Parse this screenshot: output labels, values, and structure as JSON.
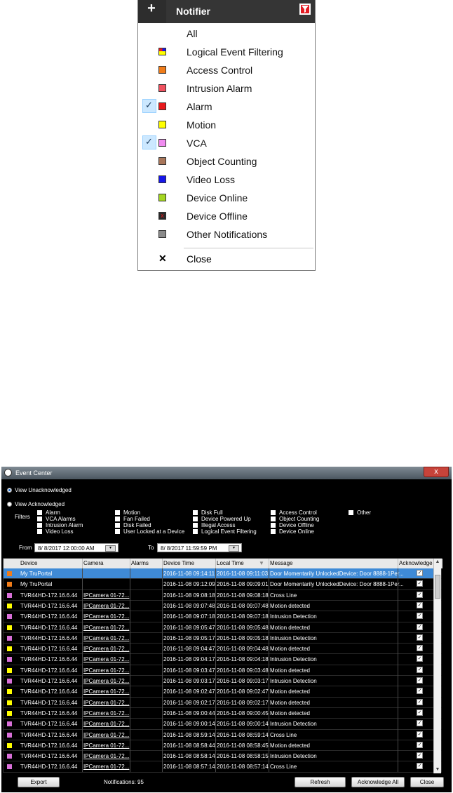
{
  "notifier": {
    "plus_label": "+",
    "title": "Notifier",
    "filter_icon": "funnel-icon",
    "items": [
      {
        "label": "All",
        "color": "",
        "checked": false,
        "icon": ""
      },
      {
        "label": "Logical Event Filtering",
        "color": "multi",
        "checked": false,
        "icon": "multicolor-square-icon"
      },
      {
        "label": "Access Control",
        "color": "#f07c19",
        "checked": false,
        "icon": ""
      },
      {
        "label": "Intrusion Alarm",
        "color": "#f0515f",
        "checked": false,
        "icon": ""
      },
      {
        "label": "Alarm",
        "color": "#e8191c",
        "checked": true,
        "icon": ""
      },
      {
        "label": "Motion",
        "color": "#ffff00",
        "checked": false,
        "icon": ""
      },
      {
        "label": "VCA",
        "color": "#f08cf0",
        "checked": true,
        "icon": ""
      },
      {
        "label": "Object Counting",
        "color": "#a8765a",
        "checked": false,
        "icon": ""
      },
      {
        "label": "Video Loss",
        "color": "#1616e8",
        "checked": false,
        "icon": ""
      },
      {
        "label": "Device Online",
        "color": "#a4d620",
        "checked": false,
        "icon": ""
      },
      {
        "label": "Device Offline",
        "color": "#2a2a2a",
        "checked": false,
        "icon": "offline-x-icon"
      },
      {
        "label": "Other Notifications",
        "color": "#8a8a8a",
        "checked": false,
        "icon": ""
      }
    ],
    "close_label": "Close"
  },
  "event_center": {
    "title": "Event Center",
    "close_glyph": "x",
    "view_unacknowledged": "View Unacknowledged",
    "view_acknowledged": "View Acknowledged",
    "filters_label": "Filters",
    "filters": [
      [
        "Alarm",
        "VCA Alarms",
        "Intrusion Alarm",
        "Video Loss"
      ],
      [
        "Motion",
        "Fan Failed",
        "Disk Failed",
        "User Locked at a Device"
      ],
      [
        "Disk Full",
        "Device Powered Up",
        "Illegal Access",
        "Logical Event Filtering"
      ],
      [
        "Access Control",
        "Object Counting",
        "Device Offline",
        "Device Online"
      ],
      [
        "Other"
      ]
    ],
    "from_label": "From",
    "from_value": "8/ 8/2017 12:00:00 AM",
    "to_label": "To",
    "to_value": "8/ 8/2017 11:59:59 PM",
    "columns": [
      "Device",
      "Camera",
      "Alarms",
      "Device Time",
      "Local Time",
      "Message",
      "Acknowledge"
    ],
    "rows": [
      {
        "color": "#f07c19",
        "device": "My TruPortal",
        "camera": "",
        "alarms": "",
        "device_time": "2016-11-08 09:14:11",
        "local_time": "2016-11-08 09:11:03",
        "message": "Door Momentarily UnlockedDevice: Door 8888-1Per...",
        "selected": true
      },
      {
        "color": "#f07c19",
        "device": "My TruPortal",
        "camera": "",
        "alarms": "",
        "device_time": "2016-11-08 09:12:09",
        "local_time": "2016-11-08 09:09:01",
        "message": "Door Momentarily UnlockedDevice: Door 8888-1Per...",
        "selected": false
      },
      {
        "color": "#d86fd8",
        "device": "TVR44HD-172.16.6.44",
        "camera": "IPCamera 01-72...",
        "alarms": "",
        "device_time": "2016-11-08 09:08:18",
        "local_time": "2016-11-08 09:08:18",
        "message": "Cross Line",
        "selected": false
      },
      {
        "color": "#ffff00",
        "device": "TVR44HD-172.16.6.44",
        "camera": "IPCamera 01-72...",
        "alarms": "",
        "device_time": "2016-11-08 09:07:48",
        "local_time": "2016-11-08 09:07:48",
        "message": "Motion detected",
        "selected": false
      },
      {
        "color": "#d86fd8",
        "device": "TVR44HD-172.16.6.44",
        "camera": "IPCamera 01-72...",
        "alarms": "",
        "device_time": "2016-11-08 09:07:18",
        "local_time": "2016-11-08 09:07:18",
        "message": "Intrusion Detection",
        "selected": false
      },
      {
        "color": "#ffff00",
        "device": "TVR44HD-172.16.6.44",
        "camera": "IPCamera 01-72...",
        "alarms": "",
        "device_time": "2016-11-08 09:05:47",
        "local_time": "2016-11-08 09:05:48",
        "message": "Motion detected",
        "selected": false
      },
      {
        "color": "#d86fd8",
        "device": "TVR44HD-172.16.6.44",
        "camera": "IPCamera 01-72...",
        "alarms": "",
        "device_time": "2016-11-08 09:05:17",
        "local_time": "2016-11-08 09:05:18",
        "message": "Intrusion Detection",
        "selected": false
      },
      {
        "color": "#ffff00",
        "device": "TVR44HD-172.16.6.44",
        "camera": "IPCamera 01-72...",
        "alarms": "",
        "device_time": "2016-11-08 09:04:47",
        "local_time": "2016-11-08 09:04:48",
        "message": "Motion detected",
        "selected": false
      },
      {
        "color": "#d86fd8",
        "device": "TVR44HD-172.16.6.44",
        "camera": "IPCamera 01-72...",
        "alarms": "",
        "device_time": "2016-11-08 09:04:17",
        "local_time": "2016-11-08 09:04:18",
        "message": "Intrusion Detection",
        "selected": false
      },
      {
        "color": "#ffff00",
        "device": "TVR44HD-172.16.6.44",
        "camera": "IPCamera 01-72...",
        "alarms": "",
        "device_time": "2016-11-08 09:03:47",
        "local_time": "2016-11-08 09:03:48",
        "message": "Motion detected",
        "selected": false
      },
      {
        "color": "#d86fd8",
        "device": "TVR44HD-172.16.6.44",
        "camera": "IPCamera 01-72...",
        "alarms": "",
        "device_time": "2016-11-08 09:03:17",
        "local_time": "2016-11-08 09:03:17",
        "message": "Intrusion Detection",
        "selected": false
      },
      {
        "color": "#ffff00",
        "device": "TVR44HD-172.16.6.44",
        "camera": "IPCamera 01-72...",
        "alarms": "",
        "device_time": "2016-11-08 09:02:47",
        "local_time": "2016-11-08 09:02:47",
        "message": "Motion detected",
        "selected": false
      },
      {
        "color": "#ffff00",
        "device": "TVR44HD-172.16.6.44",
        "camera": "IPCamera 01-72...",
        "alarms": "",
        "device_time": "2016-11-08 09:02:17",
        "local_time": "2016-11-08 09:02:17",
        "message": "Motion detected",
        "selected": false
      },
      {
        "color": "#ffff00",
        "device": "TVR44HD-172.16.6.44",
        "camera": "IPCamera 01-72...",
        "alarms": "",
        "device_time": "2016-11-08 09:00:44",
        "local_time": "2016-11-08 09:00:45",
        "message": "Motion detected",
        "selected": false
      },
      {
        "color": "#d86fd8",
        "device": "TVR44HD-172.16.6.44",
        "camera": "IPCamera 01-72...",
        "alarms": "",
        "device_time": "2016-11-08 09:00:14",
        "local_time": "2016-11-08 09:00:14",
        "message": "Intrusion Detection",
        "selected": false
      },
      {
        "color": "#d86fd8",
        "device": "TVR44HD-172.16.6.44",
        "camera": "IPCamera 01-72...",
        "alarms": "",
        "device_time": "2016-11-08 08:59:14",
        "local_time": "2016-11-08 08:59:14",
        "message": "Cross Line",
        "selected": false
      },
      {
        "color": "#ffff00",
        "device": "TVR44HD-172.16.6.44",
        "camera": "IPCamera 01-72...",
        "alarms": "",
        "device_time": "2016-11-08 08:58:44",
        "local_time": "2016-11-08 08:58:45",
        "message": "Motion detected",
        "selected": false
      },
      {
        "color": "#d86fd8",
        "device": "TVR44HD-172.16.6.44",
        "camera": "IPCamera 01-72...",
        "alarms": "",
        "device_time": "2016-11-08 08:58:14",
        "local_time": "2016-11-08 08:58:15",
        "message": "Intrusion Detection",
        "selected": false
      },
      {
        "color": "#d86fd8",
        "device": "TVR44HD-172.16.6.44",
        "camera": "IPCamera 01-72...",
        "alarms": "",
        "device_time": "2016-11-08 08:57:14",
        "local_time": "2016-11-08 08:57:14",
        "message": "Cross Line",
        "selected": false
      }
    ],
    "export_label": "Export",
    "notifications_label": "Notifications: 95",
    "refresh_label": "Refresh",
    "ack_all_label": "Acknowledge All",
    "close_label": "Close"
  }
}
